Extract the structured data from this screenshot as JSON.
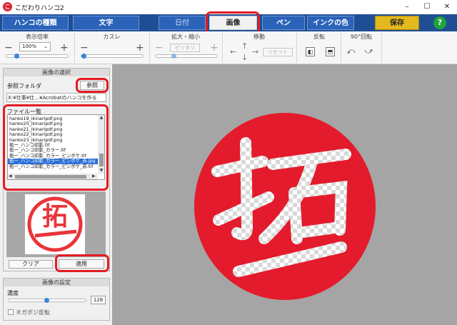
{
  "window": {
    "title": "こだわりハンコ2",
    "minimize": "–",
    "maximize": "☐",
    "close": "✕"
  },
  "nav": {
    "hanko_type": "ハンコの種類",
    "text": "文字",
    "date": "日付",
    "image": "画像",
    "pen": "ペン",
    "ink_color": "インクの色",
    "save": "保存",
    "help": "?"
  },
  "toolbar": {
    "zoom_label": "表示倍率",
    "zoom_value": "100%",
    "blur_label": "カスレ",
    "scale_label": "拡大・縮小",
    "fit_label": "ピッタリ",
    "move_label": "移動",
    "reset_label": "リセット",
    "flip_label": "反転",
    "rotate_label": "90°回転"
  },
  "image_select": {
    "header": "画像の選択",
    "ref_folder_label": "参照フォルダ",
    "browse_button": "参照",
    "path": "X:¥仕事¥仕…¥Acrobatのハンコを作る",
    "file_list_label": "ファイル一覧",
    "files": [
      "hanko19_ikinaripdf.png",
      "hanko20_ikinaripdf.png",
      "hanko21_ikinaripdf.png",
      "hanko22_ikinaripdf.png",
      "hanko23_ikinaripdf.png",
      "拓一_ハンコ印影.tif",
      "拓一_ハンコ印影_カラー.tif",
      "拓一_ハンコ印影_カラー_ピンボケ.tif",
      "拓一_ハンコ印影_カラー_ピンボケ_赤.jpg",
      "拓一_ハンコ印影_カラー_ピンボケ_赤.tif"
    ],
    "selected_index": 8,
    "preview_text": "拓",
    "clear_button": "クリア",
    "apply_button": "適用"
  },
  "image_settings": {
    "header": "画像の設定",
    "density_label": "濃度",
    "density_value": "128",
    "negapos_label": "ネガポジ反転"
  },
  "stamp": {
    "character": "拓",
    "color": "#e41b2c"
  }
}
